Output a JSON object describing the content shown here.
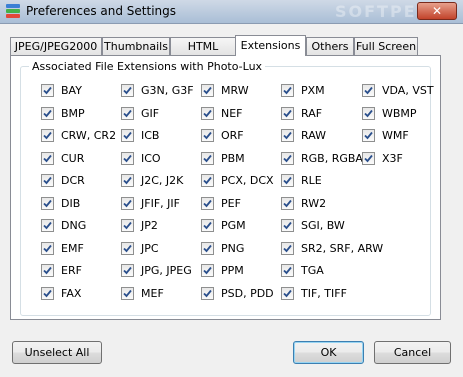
{
  "window": {
    "title": "Preferences and Settings",
    "close_glyph": "✕",
    "watermark": "SOFTPEDIA"
  },
  "tabs": [
    {
      "label": "JPEG/JPEG2000",
      "active": false
    },
    {
      "label": "Thumbnails",
      "active": false
    },
    {
      "label": "HTML Album",
      "active": false
    },
    {
      "label": "Extensions",
      "active": true
    },
    {
      "label": "Others",
      "active": false
    },
    {
      "label": "Full Screen",
      "active": false
    }
  ],
  "group": {
    "label": "Associated File Extensions with Photo-Lux"
  },
  "extensions": {
    "columns": [
      [
        "BAY",
        "BMP",
        "CRW, CR2",
        "CUR",
        "DCR",
        "DIB",
        "DNG",
        "EMF",
        "ERF",
        "FAX"
      ],
      [
        "G3N, G3F",
        "GIF",
        "ICB",
        "ICO",
        "J2C, J2K",
        "JFIF, JIF",
        "JP2",
        "JPC",
        "JPG, JPEG",
        "MEF"
      ],
      [
        "MRW",
        "NEF",
        "ORF",
        "PBM",
        "PCX, DCX",
        "PEF",
        "PGM",
        "PNG",
        "PPM",
        "PSD, PDD"
      ],
      [
        "PXM",
        "RAF",
        "RAW",
        "RGB, RGBA",
        "RLE",
        "RW2",
        "SGI, BW",
        "SR2, SRF, ARW",
        "TGA",
        "TIF, TIFF"
      ],
      [
        "VDA, VST",
        "WBMP",
        "WMF",
        "X3F"
      ]
    ],
    "all_checked": true
  },
  "buttons": {
    "unselect_all": "Unselect All",
    "ok": "OK",
    "cancel": "Cancel"
  }
}
